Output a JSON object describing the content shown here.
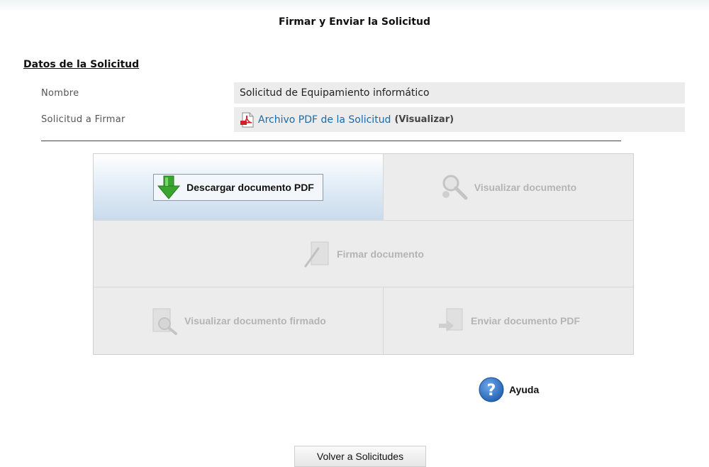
{
  "page": {
    "title": "Firmar y Enviar la Solicitud"
  },
  "section": {
    "title": "Datos de la Solicitud",
    "rows": [
      {
        "label": "Nombre",
        "value": "Solicitud de Equipamiento informático"
      },
      {
        "label": "Solicitud a Firmar",
        "link_text": "Archivo PDF de la Solicitud",
        "link_suffix": "(Visualizar)",
        "icon": "pdf-icon"
      }
    ]
  },
  "actions": {
    "download": {
      "label": "Descargar documento PDF",
      "icon": "green-down-arrow-icon",
      "enabled": true
    },
    "view": {
      "label": "Visualizar documento",
      "icon": "magnifier-icon",
      "enabled": false
    },
    "sign": {
      "label": "Firmar documento",
      "icon": "pen-sign-icon",
      "enabled": false
    },
    "view_signed": {
      "label": "Visualizar documento firmado",
      "icon": "document-magnifier-icon",
      "enabled": false
    },
    "send": {
      "label": "Enviar documento PDF",
      "icon": "send-document-icon",
      "enabled": false
    }
  },
  "help": {
    "label": "Ayuda",
    "icon": "question-circle-icon",
    "color": "#1f5fb0"
  },
  "footer": {
    "back_label": "Volver a Solicitudes"
  },
  "colors": {
    "active_cell": "#c9dbec",
    "disabled_cell": "#ececec",
    "disabled_text": "#b4b4b4",
    "link": "#1a6aa8",
    "download_arrow": "#3aa52e"
  }
}
